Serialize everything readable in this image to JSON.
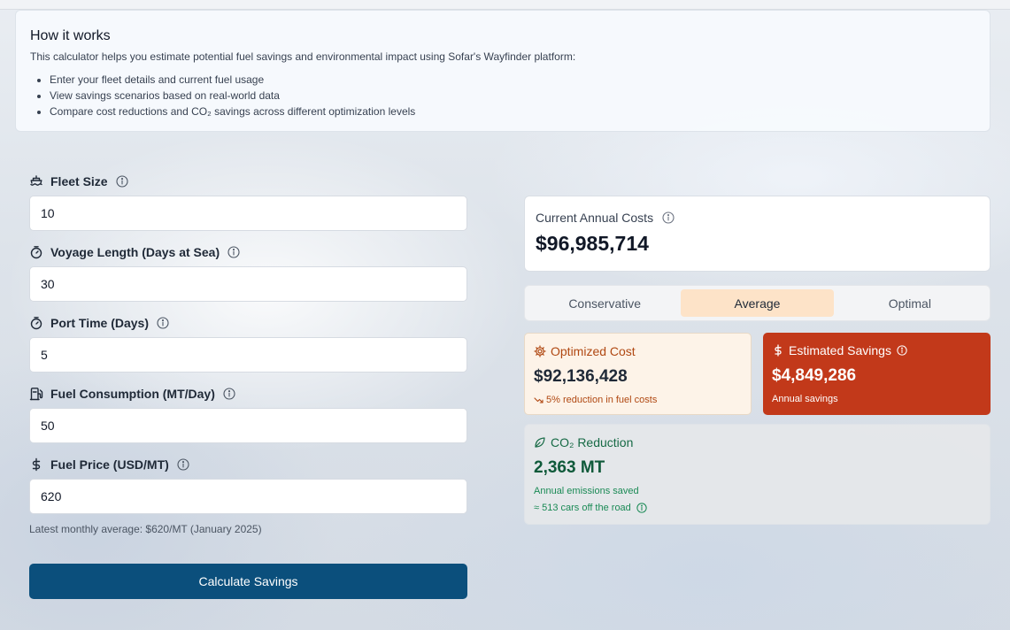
{
  "how_it_works": {
    "title": "How it works",
    "description": "This calculator helps you estimate potential fuel savings and environmental impact using Sofar's Wayfinder platform:",
    "bullets": [
      "Enter your fleet details and current fuel usage",
      "View savings scenarios based on real-world data",
      "Compare cost reductions and CO₂ savings across different optimization levels"
    ]
  },
  "form": {
    "fields": [
      {
        "label": "Fleet Size",
        "value": "10",
        "icon": "ship-icon"
      },
      {
        "label": "Voyage Length (Days at Sea)",
        "value": "30",
        "icon": "timer-icon"
      },
      {
        "label": "Port Time (Days)",
        "value": "5",
        "icon": "timer-icon"
      },
      {
        "label": "Fuel Consumption (MT/Day)",
        "value": "50",
        "icon": "fuel-icon"
      },
      {
        "label": "Fuel Price (USD/MT)",
        "value": "620",
        "icon": "dollar-icon"
      }
    ],
    "fuel_price_hint": "Latest monthly average: $620/MT (January 2025)",
    "submit_label": "Calculate Savings"
  },
  "results": {
    "current": {
      "label": "Current Annual Costs",
      "value": "$96,985,714"
    },
    "tabs": [
      {
        "label": "Conservative",
        "active": false
      },
      {
        "label": "Average",
        "active": true
      },
      {
        "label": "Optimal",
        "active": false
      }
    ],
    "optimized": {
      "title": "Optimized Cost",
      "value": "$92,136,428",
      "note": "5% reduction in fuel costs"
    },
    "savings": {
      "title": "Estimated Savings",
      "value": "$4,849,286",
      "note": "Annual savings"
    },
    "co2": {
      "title": "CO₂ Reduction",
      "value": "2,363 MT",
      "note": "Annual emissions saved",
      "cars": "≈ 513 cars off the road"
    }
  },
  "colors": {
    "primary_button": "#0b4f7c",
    "active_tab": "#fde3c8",
    "savings_card": "#c2391a",
    "optimized_card": "#fdf3e8",
    "co2_text": "#166a45"
  }
}
